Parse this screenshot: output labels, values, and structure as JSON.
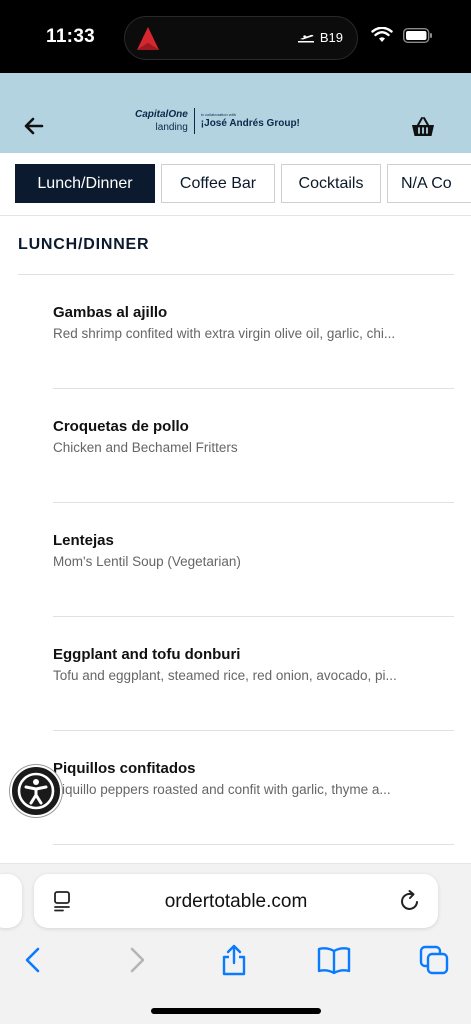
{
  "status_bar": {
    "time": "11:33",
    "flight_gate": "B19"
  },
  "header": {
    "logo_capital_one": "CapitalOne",
    "logo_landing": "landing",
    "logo_collab": "in collaboration with",
    "logo_jose_andres": "¡José Andrés Group!"
  },
  "tabs": [
    {
      "label": "Lunch/Dinner",
      "active": true
    },
    {
      "label": "Coffee Bar",
      "active": false
    },
    {
      "label": "Cocktails",
      "active": false
    },
    {
      "label": "N/A Co",
      "active": false
    }
  ],
  "section": {
    "title": "LUNCH/DINNER"
  },
  "menu_items": [
    {
      "name": "Gambas al ajillo",
      "description": "Red shrimp confited with extra virgin olive oil, garlic, chi..."
    },
    {
      "name": "Croquetas de pollo",
      "description": "Chicken and Bechamel Fritters"
    },
    {
      "name": "Lentejas",
      "description": "Mom's Lentil Soup (Vegetarian)"
    },
    {
      "name": "Eggplant and tofu donburi",
      "description": "Tofu and eggplant, steamed rice, red onion, avocado, pi..."
    },
    {
      "name": "Piquillos confitados",
      "description": "Piquillo peppers roasted and confit with garlic, thyme a..."
    }
  ],
  "browser": {
    "url": "ordertotable.com"
  },
  "colors": {
    "header_bg": "#b3d3e0",
    "navy": "#0b1a2e",
    "ios_blue": "#0a7aff"
  }
}
